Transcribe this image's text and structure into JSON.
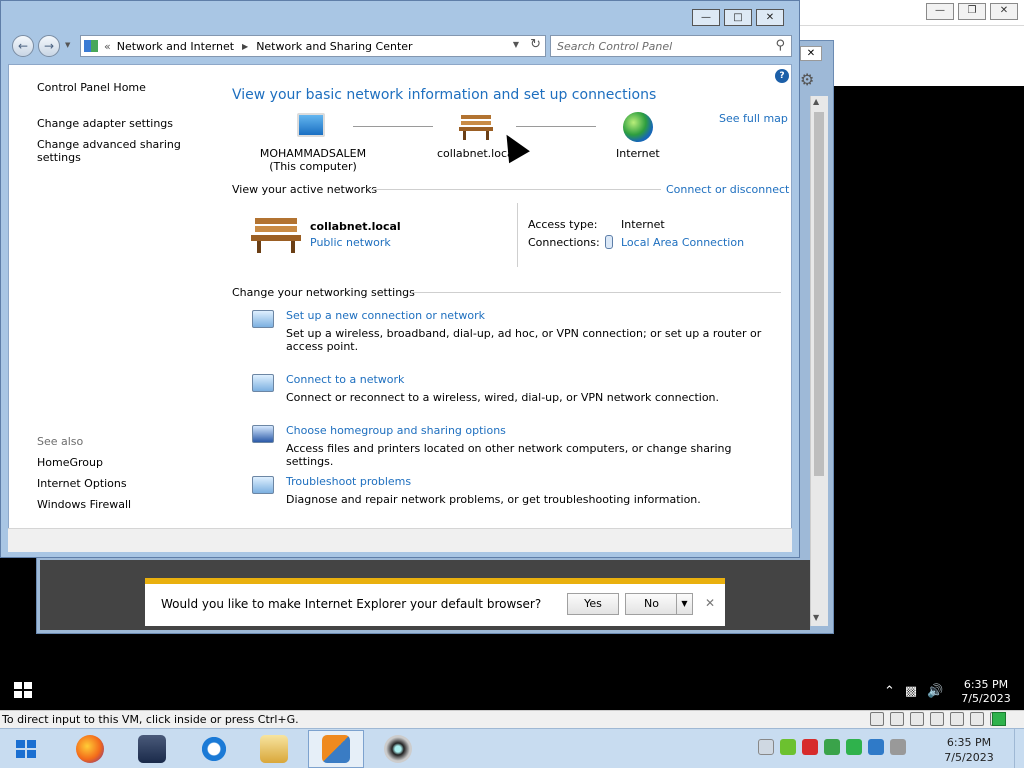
{
  "host": {
    "status_bar_text": "To direct input to this VM, click inside or press Ctrl+G.",
    "clock_time": "6:35 PM",
    "clock_date": "7/5/2023",
    "taskbar_icons": [
      "windows-start-icon",
      "firefox-icon",
      "media-player-icon",
      "internet-explorer-icon",
      "file-explorer-icon",
      "vmware-icon",
      "webcam-icon"
    ]
  },
  "guest": {
    "clock_time": "6:35 PM",
    "clock_date": "7/5/2023"
  },
  "window": {
    "breadcrumb": [
      "Network and Internet",
      "Network and Sharing Center"
    ],
    "search_placeholder": "Search Control Panel"
  },
  "sidebar": {
    "home": "Control Panel Home",
    "links": [
      "Change adapter settings",
      "Change advanced sharing settings"
    ],
    "see_also_heading": "See also",
    "see_also": [
      "HomeGroup",
      "Internet Options",
      "Windows Firewall"
    ]
  },
  "main": {
    "title": "View your basic network information and set up connections",
    "see_full_map": "See full map",
    "map": {
      "computer_name": "MOHAMMADSALEM",
      "computer_caption": "(This computer)",
      "network_name": "collabnet.local",
      "internet": "Internet"
    },
    "active_heading": "View your active networks",
    "connect_link": "Connect or disconnect",
    "active_network": {
      "name": "collabnet.local",
      "type": "Public network",
      "access_type_label": "Access type:",
      "access_type_value": "Internet",
      "connections_label": "Connections:",
      "connections_value": "Local Area Connection"
    },
    "change_heading": "Change your networking settings",
    "tasks": [
      {
        "title": "Set up a new connection or network",
        "desc": "Set up a wireless, broadband, dial-up, ad hoc, or VPN connection; or set up a router or access point."
      },
      {
        "title": "Connect to a network",
        "desc": "Connect or reconnect to a wireless, wired, dial-up, or VPN network connection."
      },
      {
        "title": "Choose homegroup and sharing options",
        "desc": "Access files and printers located on other network computers, or change sharing settings."
      },
      {
        "title": "Troubleshoot problems",
        "desc": "Diagnose and repair network problems, or get troubleshooting information."
      }
    ]
  },
  "notification": {
    "message": "Would you like to make Internet Explorer your default browser?",
    "yes": "Yes",
    "no": "No"
  }
}
